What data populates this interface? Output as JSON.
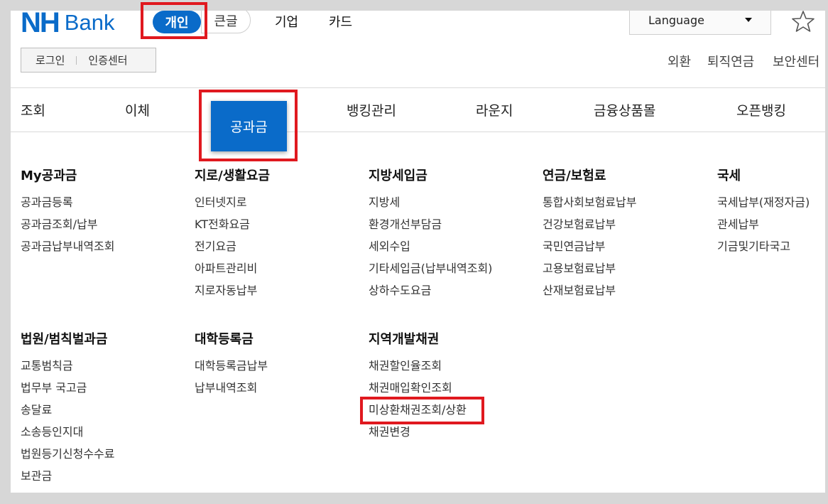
{
  "header": {
    "logo_nh": "NH",
    "logo_bank": "Bank",
    "tab_personal": "개인",
    "tab_bigfont": "큰글",
    "nav_corporate": "기업",
    "nav_card": "카드",
    "language": "Language",
    "login": "로그인",
    "cert_center": "인증센터",
    "util_forex": "외환",
    "util_pension": "퇴직연금",
    "util_security": "보안센터",
    "star_icon": "star-outline-icon",
    "accent_color": "#0a6bc9",
    "highlight_color": "#e0191f"
  },
  "gnb": {
    "inquiry": "조회",
    "transfer": "이체",
    "utility": "공과금",
    "banking_mgmt": "뱅킹관리",
    "lounge": "라운지",
    "products": "금융상품몰",
    "open_banking": "오픈뱅킹"
  },
  "menu": {
    "groups": [
      {
        "title": "My공과금",
        "items": [
          "공과금등록",
          "공과금조회/납부",
          "공과금납부내역조회"
        ]
      },
      {
        "title": "지로/생활요금",
        "items": [
          "인터넷지로",
          "KT전화요금",
          "전기요금",
          "아파트관리비",
          "지로자동납부"
        ]
      },
      {
        "title": "지방세입금",
        "items": [
          "지방세",
          "환경개선부담금",
          "세외수입",
          "기타세입금(납부내역조회)",
          "상하수도요금"
        ]
      },
      {
        "title": "연금/보험료",
        "items": [
          "통합사회보험료납부",
          "건강보험료납부",
          "국민연금납부",
          "고용보험료납부",
          "산재보험료납부"
        ]
      },
      {
        "title": "국세",
        "items": [
          "국세납부(재정자금)",
          "관세납부",
          "기금및기타국고"
        ]
      },
      {
        "title": "법원/범칙벌과금",
        "items": [
          "교통범칙금",
          "법무부 국고금",
          "송달료",
          "소송등인지대",
          "법원등기신청수수료",
          "보관금"
        ]
      },
      {
        "title": "대학등록금",
        "items": [
          "대학등록금납부",
          "납부내역조회"
        ]
      },
      {
        "title": "지역개발채권",
        "items": [
          "채권할인율조회",
          "채권매입확인조회",
          "미상환채권조회/상환",
          "채권변경"
        ]
      }
    ]
  }
}
